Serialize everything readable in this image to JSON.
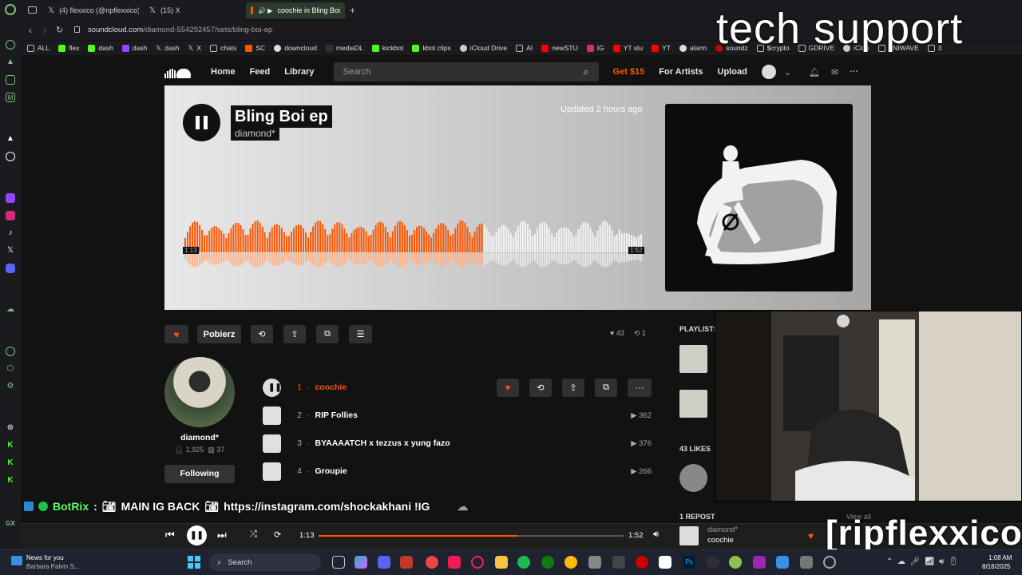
{
  "browser": {
    "tabs": [
      {
        "label": "(4) flexxico (@ripflexxico)"
      },
      {
        "label": "(15) X"
      },
      {
        "label": "coochie in Bling Boi"
      }
    ],
    "new_tab": "+",
    "url_host": "soundcloud.com",
    "url_path": "/diamond-554292457/sets/bling-boi-ep",
    "bookmarks": [
      "ALL",
      "flex",
      "dash",
      "dash",
      "dash",
      "X",
      "chats",
      "SC",
      "downcloud",
      "mediaDL",
      "kickbot",
      "kbot clips",
      "iCloud Drive",
      "AI",
      "newSTU",
      "IG",
      "YT stu",
      "YT",
      "alarm",
      "soundz",
      "$crypto",
      "GDRIVE",
      "iClou",
      "ANIWAVE",
      "3"
    ]
  },
  "soundcloud": {
    "nav": {
      "home": "Home",
      "feed": "Feed",
      "library": "Library",
      "search_placeholder": "Search",
      "get": "Get $15",
      "for_artists": "For Artists",
      "upload": "Upload"
    },
    "hero": {
      "title": "Bling Boi ep",
      "artist": "diamond*",
      "updated": "Updated 2 hours ago",
      "elapsed": "1:13",
      "duration": "1:52",
      "progress": 0.652
    },
    "actions": {
      "download": "Pobierz"
    },
    "stats": {
      "likes": "43",
      "reposts": "1"
    },
    "user": {
      "name": "diamond*",
      "followers": "1,925",
      "tracks": "37",
      "follow_label": "Following"
    },
    "tracks": [
      {
        "num": "1",
        "name": "coochie",
        "plays": ""
      },
      {
        "num": "2",
        "name": "RIP Follies",
        "plays": "362"
      },
      {
        "num": "3",
        "name": "BYAAAATCH x tezzus x yung fazo",
        "plays": "376"
      },
      {
        "num": "4",
        "name": "Groupie",
        "plays": "266"
      }
    ],
    "sidebar": {
      "playlists": "PLAYLISTS",
      "likes": "43 LIKES",
      "repost": "1 REPOST",
      "view_all": "View all"
    },
    "player": {
      "elapsed": "1:13",
      "duration": "1:52",
      "progress": 0.652,
      "artist": "diamond*",
      "title": "coochie"
    }
  },
  "overlay": {
    "tech_support": "tech support",
    "handle": "[ripflexxico]",
    "chat_user": "BotRix",
    "chat_msg": "MAIN IG BACK",
    "chat_link": "https://instagram.com/shockakhani !IG"
  },
  "taskbar": {
    "news_title": "News for you",
    "news_sub": "Barbara Palvin S...",
    "search": "Search",
    "time": "1:08 AM",
    "date": "8/18/2025"
  },
  "colors": {
    "accent": "#ff5500",
    "background": "#121212"
  }
}
